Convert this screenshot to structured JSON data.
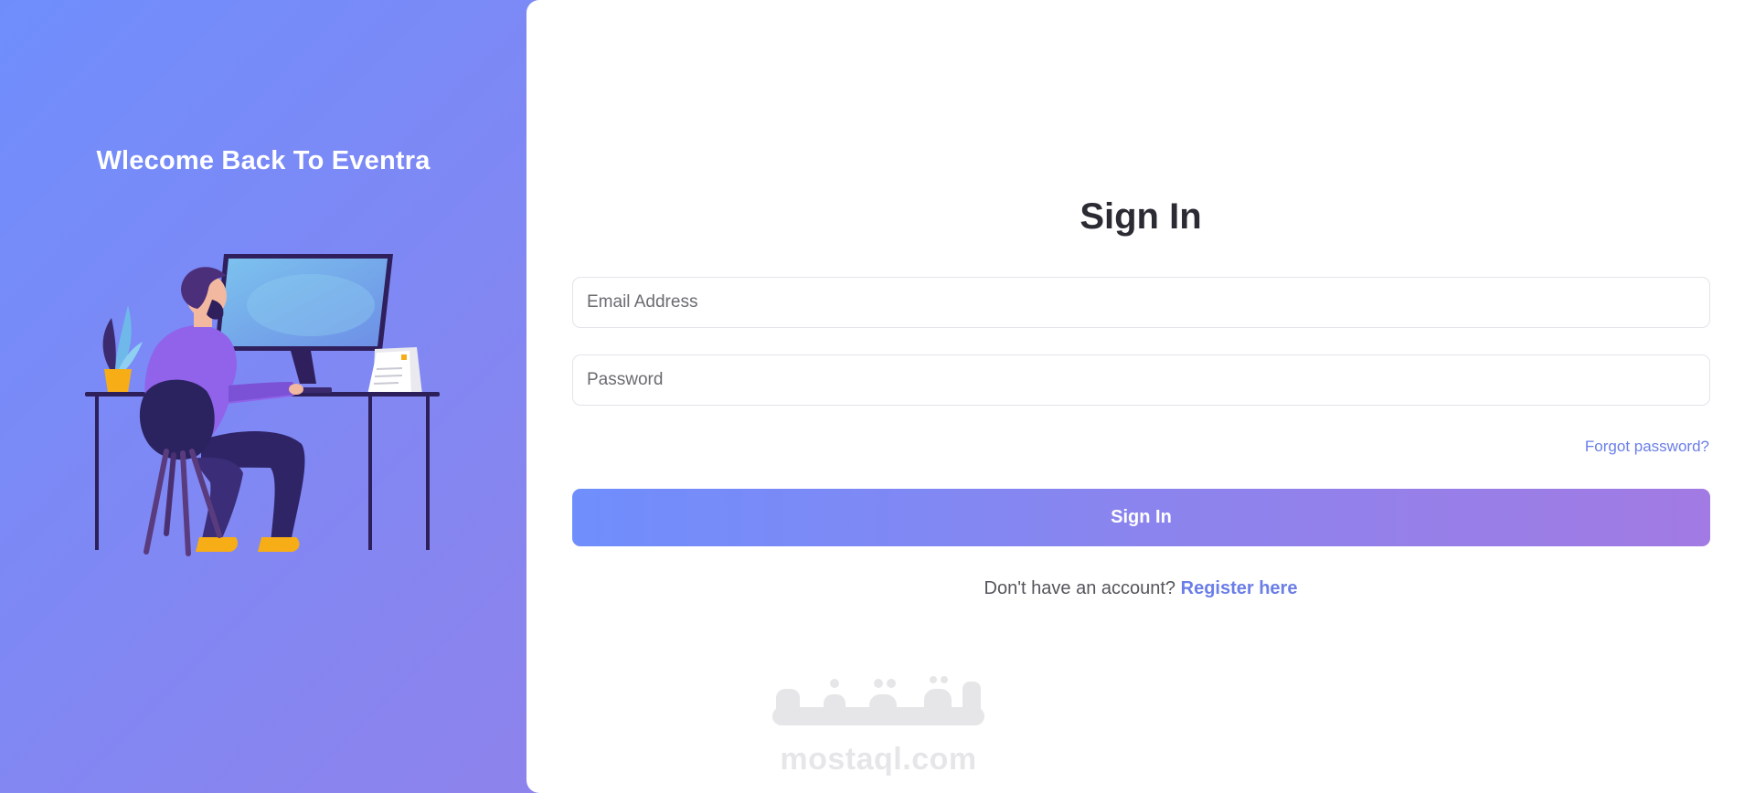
{
  "left_panel": {
    "welcome_title": "Wlecome Back To Eventra",
    "illustration_icon": "person-at-desk-illustration"
  },
  "form": {
    "title": "Sign In",
    "email": {
      "placeholder": "Email Address",
      "value": ""
    },
    "password": {
      "placeholder": "Password",
      "value": ""
    },
    "forgot_label": "Forgot password?",
    "submit_label": "Sign In",
    "register_prompt": "Don't have an account?",
    "register_link": "Register here"
  },
  "watermark": {
    "logo_icon": "mostaql-logo",
    "arabic_text": "مستقل",
    "url_text": "mostaql.com"
  },
  "colors": {
    "gradient_start": "#6f8efc",
    "gradient_end": "#a27ae3",
    "link": "#6b7ee8",
    "title_text": "#2b2b33"
  }
}
